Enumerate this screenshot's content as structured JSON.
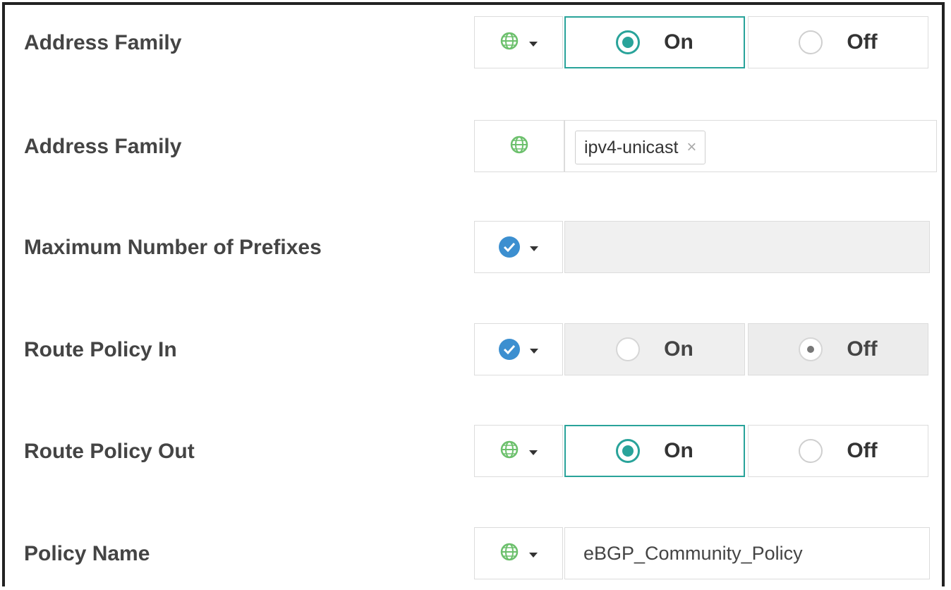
{
  "rows": [
    {
      "label": "Address Family",
      "on": "On",
      "off": "Off"
    },
    {
      "label": "Address Family",
      "tag": "ipv4-unicast",
      "tag_remove": "×"
    },
    {
      "label": "Maximum Number of Prefixes",
      "value": ""
    },
    {
      "label": "Route Policy In",
      "on": "On",
      "off": "Off"
    },
    {
      "label": "Route Policy Out",
      "on": "On",
      "off": "Off"
    },
    {
      "label": "Policy Name",
      "value": "eBGP_Community_Policy"
    }
  ],
  "icons": {
    "scope_global": "globe-icon",
    "scope_device": "check-circle-icon",
    "dropdown": "caret-down-icon"
  },
  "colors": {
    "accent": "#29a39a",
    "globe": "#6cc06c",
    "check": "#3c8fd0",
    "label": "#444444",
    "disabled_bg": "#efefef"
  },
  "state": {
    "address_family_toggle": "On",
    "route_policy_in": "Off",
    "route_policy_out": "On",
    "route_policy_in_disabled": true,
    "max_prefixes_disabled": true
  }
}
